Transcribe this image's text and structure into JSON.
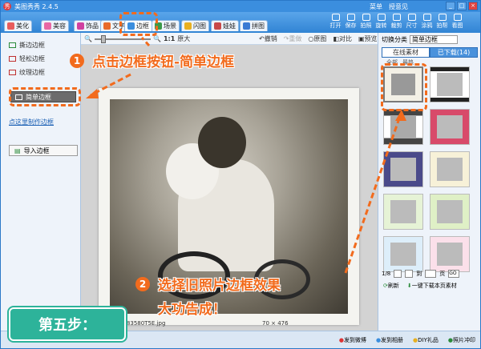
{
  "window": {
    "title": "美图秀秀 2.4.5",
    "menu": [
      "菜单",
      "授意见"
    ],
    "controls": [
      "_",
      "□",
      "×"
    ]
  },
  "toolbar": {
    "tabs": [
      {
        "label": "美化",
        "icon": "beautify-icon",
        "color": "#e85c5c"
      },
      {
        "label": "美容",
        "icon": "makeup-icon",
        "color": "#e868a4"
      },
      {
        "label": "饰品",
        "icon": "accessory-icon",
        "color": "#d040a0"
      },
      {
        "label": "文字",
        "icon": "text-icon",
        "color": "#e86a2a"
      },
      {
        "label": "边框",
        "icon": "frame-icon",
        "color": "#3b8ede"
      },
      {
        "label": "场景",
        "icon": "scene-icon",
        "color": "#3a9a4a"
      },
      {
        "label": "闪图",
        "icon": "flash-icon",
        "color": "#e8b020"
      },
      {
        "label": "娃娃",
        "icon": "doll-icon",
        "color": "#c84848"
      },
      {
        "label": "拼图",
        "icon": "puzzle-icon",
        "color": "#3a7ad4"
      }
    ],
    "tools": [
      "打开",
      "保存",
      "拍照",
      "旋转",
      "裁剪",
      "尺寸",
      "涂鸦",
      "拍帮",
      "看图"
    ]
  },
  "left_panel": {
    "items": [
      "撕边边框",
      "轻松边框",
      "纹理边框",
      "",
      "简单边框"
    ],
    "selected_label": "简单边框",
    "link": "点这里制作边框",
    "import_button": "导入边框"
  },
  "canvas_bar": {
    "zoom_label": "1:1",
    "zoom_mode": "原大",
    "actions": [
      "撤销",
      "重做",
      "原图",
      "对比",
      "预览"
    ]
  },
  "canvas_footer": {
    "filename": "4383580T5E.jpg",
    "dimensions": "70 × 476"
  },
  "right_panel": {
    "category_label": "切换分类",
    "category_value": "简单边框",
    "tabs": [
      "在线素材",
      "已下载(14)"
    ],
    "subtabs": [
      "全部",
      "最热"
    ],
    "pager": {
      "current": "1/8",
      "go": "GO",
      "page_word": "页",
      "to": "到"
    },
    "refresh": "刷新",
    "download_all": "一键下载本页素材"
  },
  "status_bar": {
    "links": [
      "发到微博",
      "发到相册",
      "DIY礼品",
      "照片冲印"
    ]
  },
  "overlays": {
    "step1_num": "1",
    "step1_text": "点击边框按钮-简单边框",
    "step2_num": "2",
    "step2_line1": "选择旧照片边框效果",
    "step2_line2": "大功告成！",
    "badge": "第五步："
  }
}
